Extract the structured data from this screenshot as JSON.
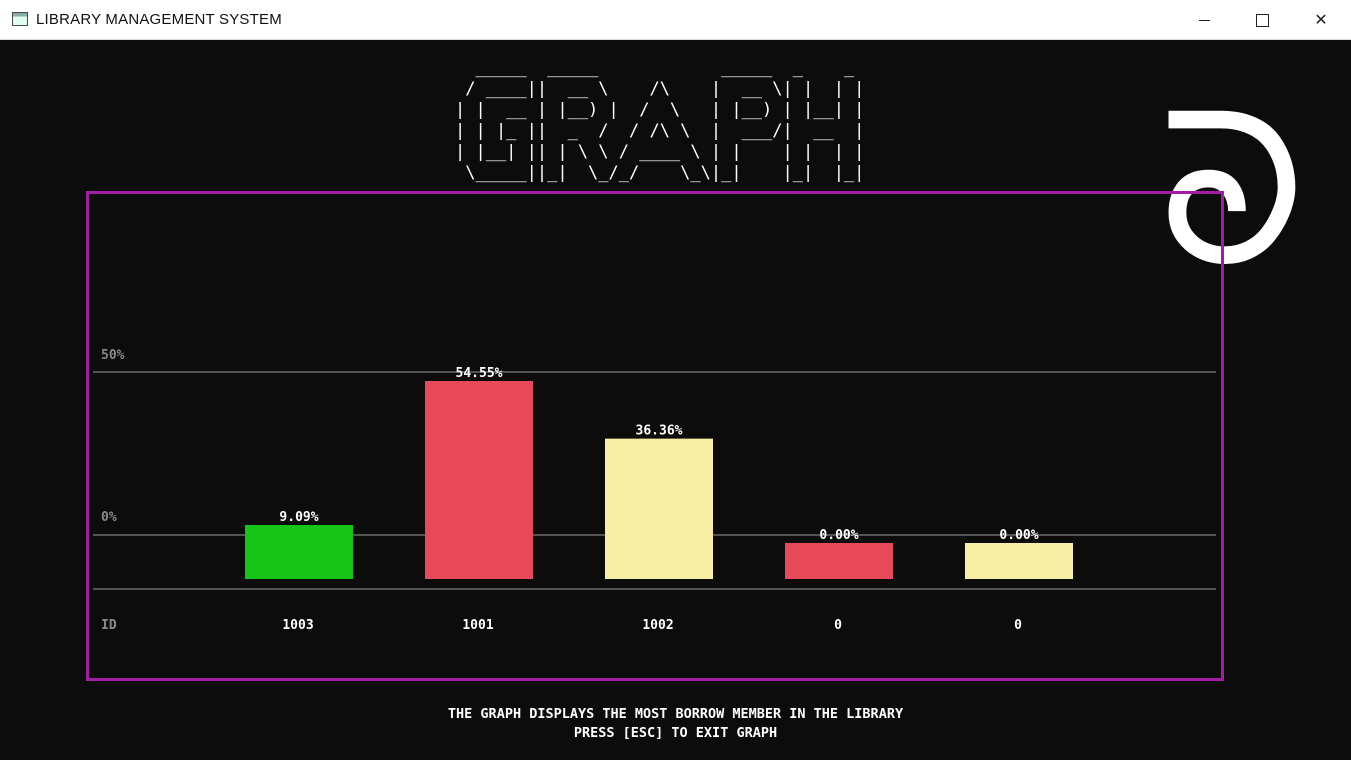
{
  "window": {
    "title": "LIBRARY MANAGEMENT SYSTEM",
    "minimize_symbol": "—",
    "close_symbol": "✕"
  },
  "banner": {
    "text": "GRAPH",
    "ascii_art": "  _____  _____            _____  _    _ \n / ____||  __ \\    /\\    |  __ \\| |  | |\n| |  __ | |__) |  /  \\   | |__) | |__| |\n| | |_ ||  _  /  / /\\ \\  |  ___/|  __  |\n| |__| || | \\ \\ / ____ \\ | |    | |  | |\n \\_____||_|  \\_/_/    \\_\\|_|    |_|  |_|"
  },
  "decoration_glyph": "ᘐ",
  "colors": {
    "background": "#0c0c0c",
    "frame": "#a21ca6",
    "gridline": "#9a9a9a",
    "axis_label": "#8a8a8a",
    "value_text": "#ffffff"
  },
  "chart_data": {
    "type": "bar",
    "y_tick_labels": [
      "50%",
      "0%"
    ],
    "x_axis_label": "ID",
    "categories": [
      "1003",
      "1001",
      "1002",
      "0",
      "0"
    ],
    "values": [
      9.09,
      54.55,
      36.36,
      0.0,
      0.0
    ],
    "value_labels": [
      "9.09%",
      "54.55%",
      "36.36%",
      "0.00%",
      "0.00%"
    ],
    "bar_colors": [
      "#15c515",
      "#e84a5a",
      "#f8eea4",
      "#e84a5a",
      "#f8eea4"
    ],
    "grid": true
  },
  "footer": {
    "line1": "THE GRAPH DISPLAYS THE MOST BORROW MEMBER IN THE LIBRARY",
    "line2": "PRESS [ESC] TO EXIT GRAPH"
  }
}
